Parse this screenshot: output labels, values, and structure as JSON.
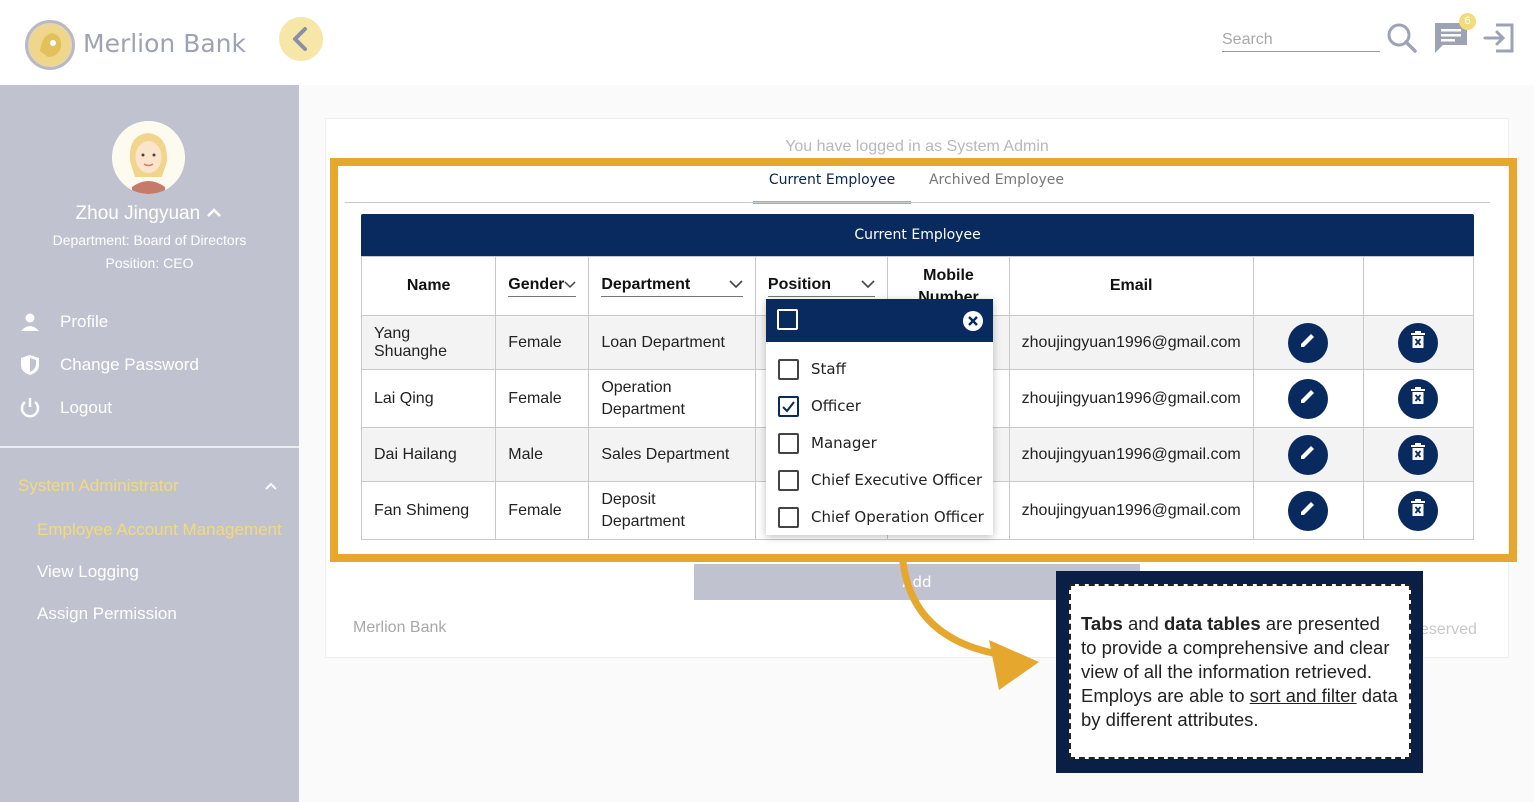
{
  "header": {
    "brand": "Merlion Bank",
    "search_placeholder": "Search",
    "notification_count": "6"
  },
  "sidebar": {
    "user_name": "Zhou Jingyuan",
    "department": "Department: Board of Directors",
    "position": "Position: CEO",
    "nav": [
      {
        "label": "Profile",
        "icon": "person-icon"
      },
      {
        "label": "Change Password",
        "icon": "shield-icon"
      },
      {
        "label": "Logout",
        "icon": "power-icon"
      }
    ],
    "section_title": "System Administrator",
    "sub_items": [
      "Employee Account Management",
      "View Logging",
      "Assign Permission"
    ],
    "active_color": "#f3d97a"
  },
  "main": {
    "logged_in_text": "You have logged in as System Admin",
    "tabs": [
      "Current Employee",
      "Archived Employee"
    ],
    "table_title": "Current Employee",
    "columns": [
      "Name",
      "Gender",
      "Department",
      "Position",
      "Mobile Number",
      "Email"
    ],
    "rows": [
      {
        "name": "Yang Shuanghe",
        "gender": "Female",
        "department": "Loan Department",
        "email": "zhoujingyuan1996@gmail.com"
      },
      {
        "name": "Lai Qing",
        "gender": "Female",
        "department": "Operation Department",
        "email": "zhoujingyuan1996@gmail.com"
      },
      {
        "name": "Dai Hailang",
        "gender": "Male",
        "department": "Sales Department",
        "email": "zhoujingyuan1996@gmail.com"
      },
      {
        "name": "Fan Shimeng",
        "gender": "Female",
        "department": "Deposit Department",
        "email": "zhoujingyuan1996@gmail.com"
      }
    ],
    "position_filter": {
      "options": [
        {
          "label": "Staff",
          "checked": false
        },
        {
          "label": "Officer",
          "checked": true
        },
        {
          "label": "Manager",
          "checked": false
        },
        {
          "label": "Chief Executive Officer",
          "checked": false
        },
        {
          "label": "Chief Operation Officer",
          "checked": false
        }
      ]
    },
    "add_label": "Add",
    "footer_brand": "Merlion Bank",
    "footer_right": "eserved"
  },
  "annotation": {
    "bold1": "Tabs",
    "t1": " and ",
    "bold2": "data tables",
    "t2": " are presented to provide a comprehensive and clear view of all the information retrieved. Employs are able to ",
    "u1": "sort and filter",
    "t3": " data by different attributes."
  },
  "colors": {
    "navy": "#082a5e",
    "highlight": "#e6a72e",
    "sidebar": "#c0c3cf"
  }
}
